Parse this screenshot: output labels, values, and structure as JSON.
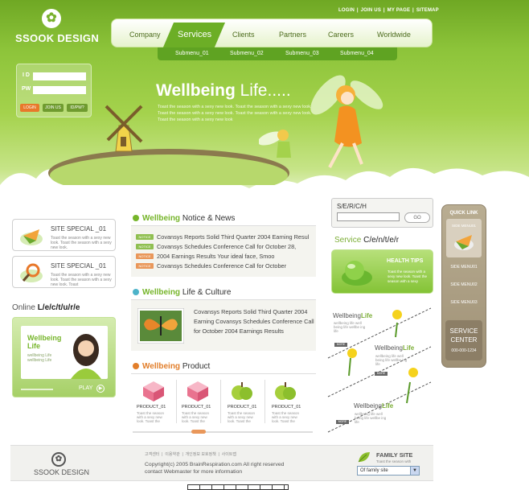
{
  "logo": {
    "text": "SSOOK DESIGN",
    "icon": "butterfly-icon"
  },
  "top_links": [
    "LOGIN",
    "JOIN US",
    "MY PAGE",
    "SITEMAP"
  ],
  "nav": {
    "items": [
      "Company",
      "Services",
      "Clients",
      "Partners",
      "Careers",
      "Worldwide"
    ],
    "active": "Services",
    "submenu": [
      "Submenu_01",
      "Submenu_02",
      "Submenu_03",
      "Submenu_04"
    ]
  },
  "login": {
    "id_label": "I D",
    "pw_label": "PW",
    "buttons": [
      "LOGIN",
      "JOIN US",
      "ID/PW?"
    ]
  },
  "hero": {
    "title_bold": "Wellbeing",
    "title_rest": " Life.....",
    "desc": "Toast the season with a sexy new look. Toast the season with a sexy new look. Toast the season with a sexy new look. Toast the season with a sexy new look. Toast the season with a sexy new look"
  },
  "specials": [
    {
      "title": "SITE SPECIAL _01",
      "text": "Toast the season with a sexy new look. Toast the season with a sexy new look."
    },
    {
      "title": "SITE SPECIAL _01",
      "text": "Toast the season with a sexy new look. Toast the season with a sexy new look. Toast"
    }
  ],
  "online_lecture": {
    "title_plain": "Online ",
    "title_bold": "L/e/c/t/u/r/e",
    "card_title": "Wellbeing Life",
    "card_desc": "wellbeing Life wellbeing Life",
    "play": "PLAY"
  },
  "news": {
    "head_green": "Wellbeing",
    "head_rest": " Notice & News",
    "tag": "NOTICE",
    "items": [
      "Covansys Reports Solid Third Quarter 2004 Earning Resul",
      "Covansys Schedules Conference Call for October 28,",
      "2004 Earnings Results Your ideal face, Smoo",
      "Covansys Schedules Conference Call for October"
    ]
  },
  "life_culture": {
    "head_green": "Wellbeing",
    "head_rest": " Life & Culture",
    "text": "Covansys Reports Solid Third Quarter 2004 Earning Covansys Schedules Conference Call for October 2004 Earnings Results"
  },
  "products": {
    "head_orange": "Wellbeing",
    "head_rest": " Product",
    "items": [
      {
        "name": "PRODUCT_01",
        "desc": "Toast the season with a sexy new look. Toast the"
      },
      {
        "name": "PRODUCT_01",
        "desc": "Toast the season with a sexy new look. Toast the"
      },
      {
        "name": "PRODUCT_01",
        "desc": "Toast the season with a sexy new look. Toast the"
      },
      {
        "name": "PRODUCT_01",
        "desc": "Toast the season with a sexy new look. Toast the"
      }
    ]
  },
  "search": {
    "label": "S/E/R/C/H",
    "button": "GO"
  },
  "service": {
    "title_plain": "Service ",
    "title_bold": "C/e/n/t/e/r",
    "health_title": "HEALTH TIPS",
    "health_desc": "Toast the season with a sexy new look. Toast the season with a sexy"
  },
  "wellbeing_life": {
    "title_plain": "Wellbeing",
    "title_bold": "Life",
    "desc": "wellbeing life well being life wellbe ing life",
    "more": "MORE"
  },
  "quick_link": {
    "title": "QUICK LINK",
    "menus": [
      "SIDE MENU01",
      "SIDE MENU01",
      "SIDE MENU02",
      "SIDE MENU03"
    ],
    "service_center": [
      "SERVICE",
      "CENTER"
    ],
    "phone": "000-000-1234"
  },
  "footer": {
    "logo": "SSOOK DESIGN",
    "links": [
      "고객센터",
      "이용약관",
      "개인정보 보호정책",
      "사이트맵"
    ],
    "copyright": "Copyright(c) 2005 BrainRespiration.com All right reserved",
    "contact": "contact Webmaster for more information",
    "family_title": "FAMILY SITE",
    "family_sub": "Toast the season with",
    "family_select": "Of family site"
  },
  "colors": {
    "green": "#76b52a",
    "orange": "#e27e2a",
    "brown": "#a39479"
  }
}
